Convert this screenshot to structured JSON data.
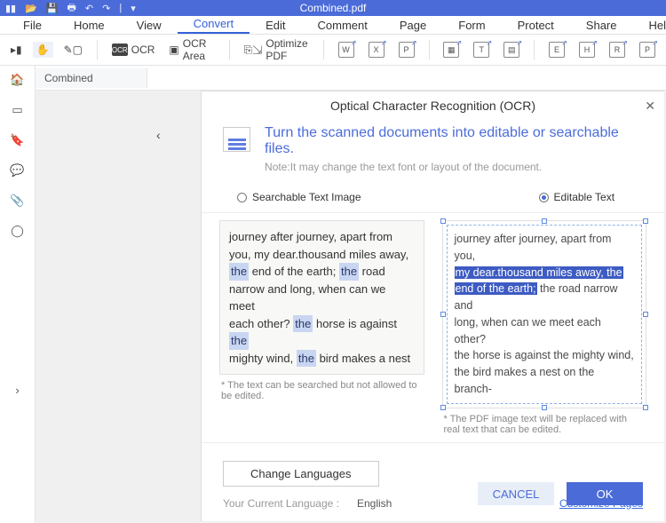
{
  "titlebar": {
    "title": "Combined.pdf"
  },
  "menu": {
    "file": "File",
    "home": "Home",
    "view": "View",
    "convert": "Convert",
    "edit": "Edit",
    "comment": "Comment",
    "page": "Page",
    "form": "Form",
    "protect": "Protect",
    "share": "Share",
    "help": "Help"
  },
  "toolbar": {
    "ocr": "OCR",
    "ocr_area": "OCR Area",
    "optimize": "Optimize PDF"
  },
  "tab": {
    "name": "Combined"
  },
  "dialog": {
    "title": "Optical Character Recognition (OCR)",
    "headline": "Turn the scanned documents into editable or searchable files.",
    "note": "Note:It may change the text font or layout of the document.",
    "opt_searchable": "Searchable Text Image",
    "opt_editable": "Editable Text",
    "preview1": {
      "l1a": "journey after journey, apart from",
      "l2a": "you, my dear.thousand miles away,",
      "l3_hl1": "the",
      "l3_mid": " end of the earth; ",
      "l3_hl2": "the",
      "l3_end": " road",
      "l4": "narrow and long, when can we meet",
      "l5a": "each other? ",
      "l5_hl": "the",
      "l5b": " horse is against ",
      "l5_hl2": "the",
      "l6a": "mighty wind, ",
      "l6_hl": "the",
      "l6b": " bird makes a nest",
      "caption": "* The text can be searched but not allowed to be edited."
    },
    "preview2": {
      "l1": "journey after journey, apart from you,",
      "l2_sel": "my dear.thousand miles away, the",
      "l3_sel": "end of the earth;",
      "l3_rest": " the road narrow and",
      "l4": "long, when can we meet each other?",
      "l5": "the horse is against the mighty wind,",
      "l6": "the bird makes a nest on the branch-",
      "caption": "* The PDF image text will be replaced with real text that can be edited."
    },
    "change_lang": "Change Languages",
    "cur_lang_label": "Your Current Language :",
    "cur_lang_value": "English",
    "customize": "Customize Pages",
    "cancel": "CANCEL",
    "ok": "OK"
  }
}
